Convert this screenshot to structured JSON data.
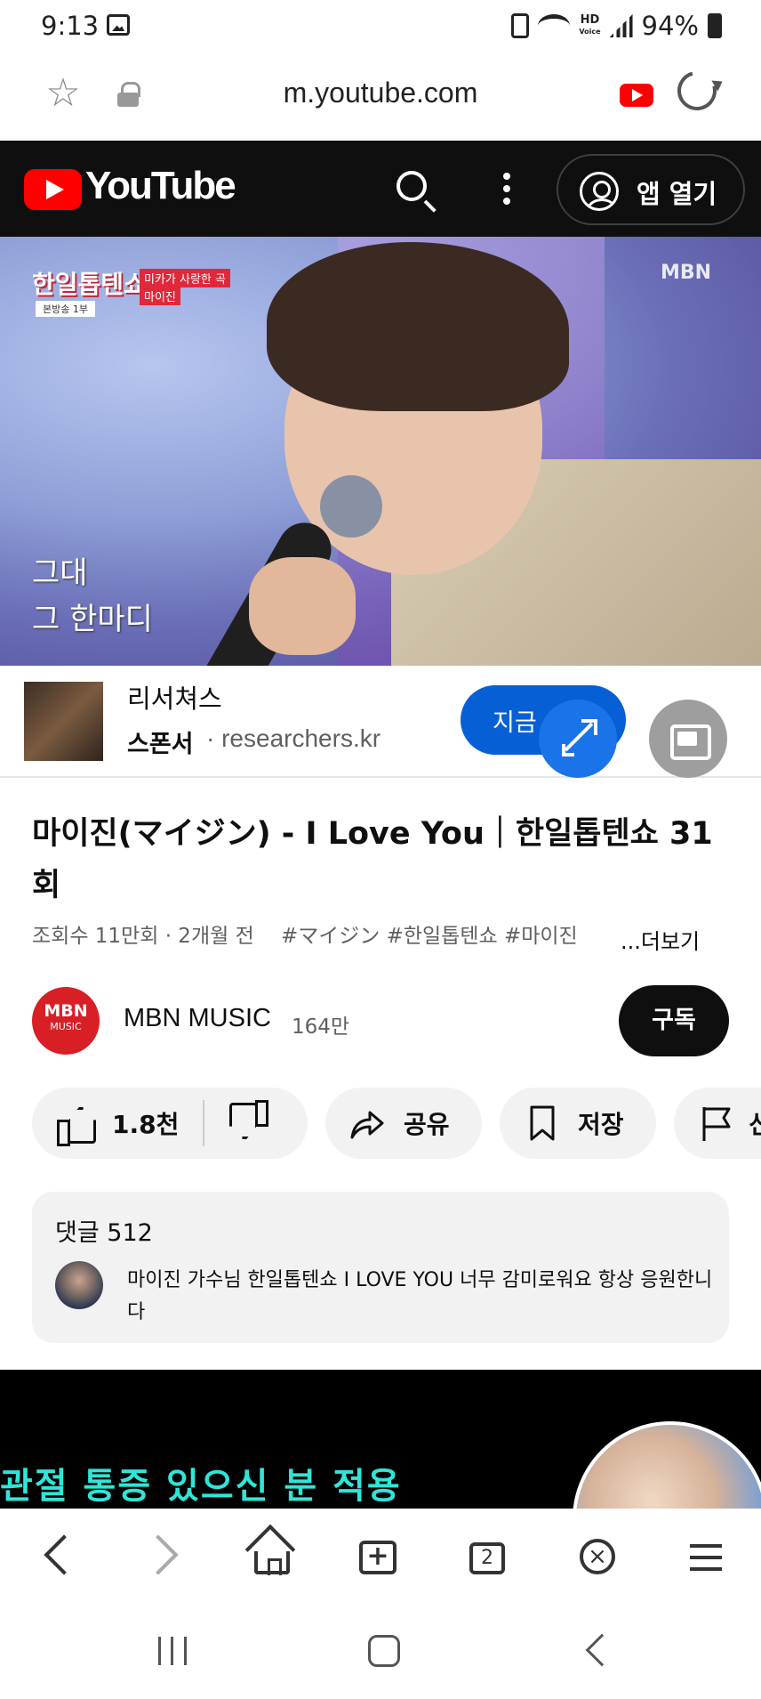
{
  "status_bar": {
    "time": "9:13",
    "hd_label": "HD",
    "voice_label": "Voice",
    "battery": "94%"
  },
  "browser": {
    "url": "m.youtube.com"
  },
  "yt_header": {
    "logo": "YouTube",
    "open_app_label": "앱 열기"
  },
  "video": {
    "show_logo": "한일톱텐쇼",
    "tag_top": "미카가 사랑한 곡",
    "tag_name": "마이진",
    "tag_broadcast": "본방송 1부",
    "channel_bug": "MBN",
    "lyrics_line1": "그대",
    "lyrics_line2": "그 한마디"
  },
  "sponsor": {
    "name": "리서쳐스",
    "badge": "스폰서",
    "url": "· researchers.kr",
    "cta": "지금"
  },
  "details": {
    "title": "마이진(マイジン) - I Love You｜한일톱텐쇼 31회",
    "meta": "조회수 11만회 · 2개월 전",
    "tags": "#マイジン #한일톱텐쇼 #마이진",
    "more": "...더보기"
  },
  "channel": {
    "avatar_top": "MBN",
    "avatar_bottom": "MUSIC",
    "name": "MBN MUSIC",
    "subscribers": "164만",
    "subscribe_label": "구독"
  },
  "actions": {
    "likes": "1.8천",
    "share": "공유",
    "save": "저장",
    "report": "신"
  },
  "comments": {
    "label": "댓글 512",
    "top_comment": "마이진 가수님 한일톱텐쇼 I LOVE YOU 너무 감미로워요 항상 응원한니다"
  },
  "ad": {
    "text": "관절 통증 있으신 분 적용"
  },
  "toolbar": {
    "tabs_count": "2"
  },
  "icons": {
    "accent": "#ff0000",
    "sponsor_blue": "#065fd4",
    "ad_text_color": "#2fe5d8"
  }
}
